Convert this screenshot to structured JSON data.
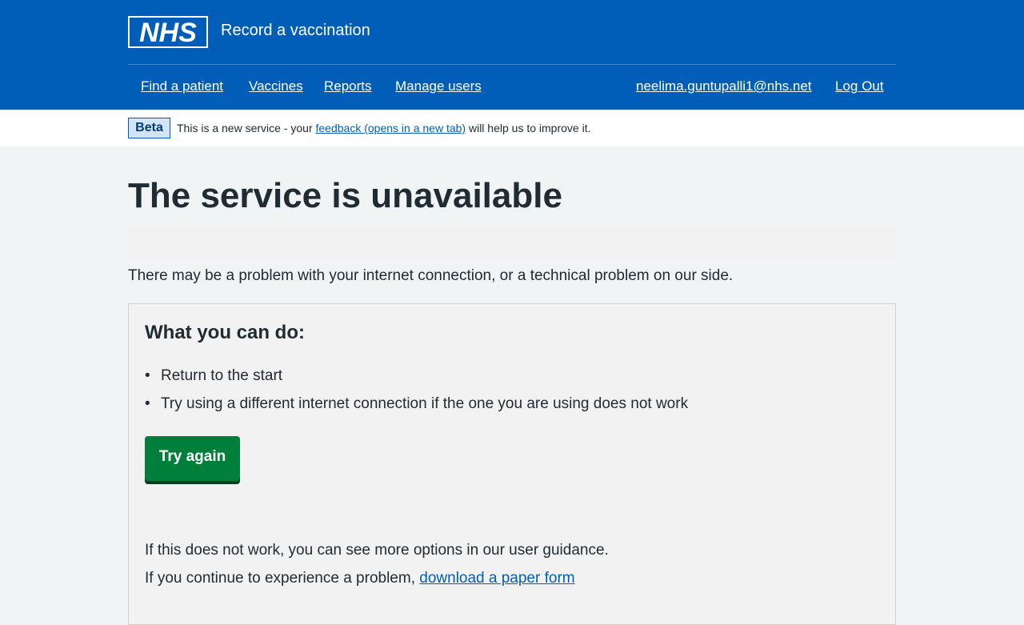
{
  "header": {
    "logo_text": "NHS",
    "service_name": "Record a vaccination",
    "nav": {
      "find_patient": "Find a patient",
      "vaccines": "Vaccines",
      "reports": "Reports",
      "manage_users": "Manage users",
      "user_email": "neelima.guntupalli1@nhs.net",
      "log_out": "Log Out"
    }
  },
  "beta": {
    "tag": "Beta",
    "text_before": "This is a new service - your ",
    "link": "feedback (opens in a new tab)",
    "text_after": " will help us to improve it."
  },
  "main": {
    "title": "The service is unavailable",
    "intro": "There may be a problem with your internet connection, or a technical problem on our side.",
    "panel": {
      "heading": "What you can do:",
      "items": [
        "Return to the start",
        "Try using a different internet connection if the one you are using does not work"
      ],
      "button": "Try again",
      "note": "If this does not work, you can see more options in our user guidance.",
      "note2_before": "If you continue to experience a problem, ",
      "note2_link": "download a paper form"
    }
  },
  "colors": {
    "header_bg": "#005eb8",
    "page_bg": "#f0f4f5",
    "button_bg": "#007f3b",
    "link": "#005eb8"
  }
}
